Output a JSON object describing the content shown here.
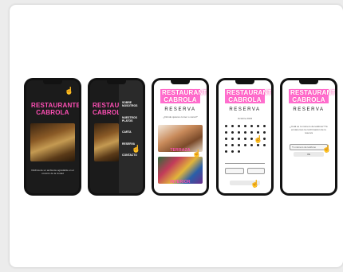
{
  "phones": [
    {
      "title": "RESTAURANTE CABROLA",
      "caption": "Disfruta de un ambiente agradable en el corazón de la ciudad"
    },
    {
      "title": "RESTAURANTE CABROLA",
      "menu": [
        "SOBRE NOSOTROS",
        "NUESTROS PLATOS",
        "CARTA",
        "RESERVA",
        "CONTACTO"
      ]
    },
    {
      "title": "RESTAURANTE CABROLA",
      "heading": "RESERVA",
      "question": "¿Dónde quieres comer o cenar?",
      "options": [
        "TERRAZA",
        "INTERIOR"
      ]
    },
    {
      "title": "RESTAURANTE CABROLA",
      "heading": "RESERVA",
      "month": "Octubre 2023"
    },
    {
      "title": "RESTAURANTE CABROLA",
      "heading": "RESERVA",
      "message": "¿Cuál es tu número de teléfono? Te enviaremos la confirmación de tu reserva",
      "field": "Tu número de teléfono",
      "button": "Ok"
    }
  ],
  "colors": {
    "accent": "#ff4fb5",
    "phone": "#121212"
  },
  "icons": {
    "cursor": "hand-cursor-icon"
  }
}
